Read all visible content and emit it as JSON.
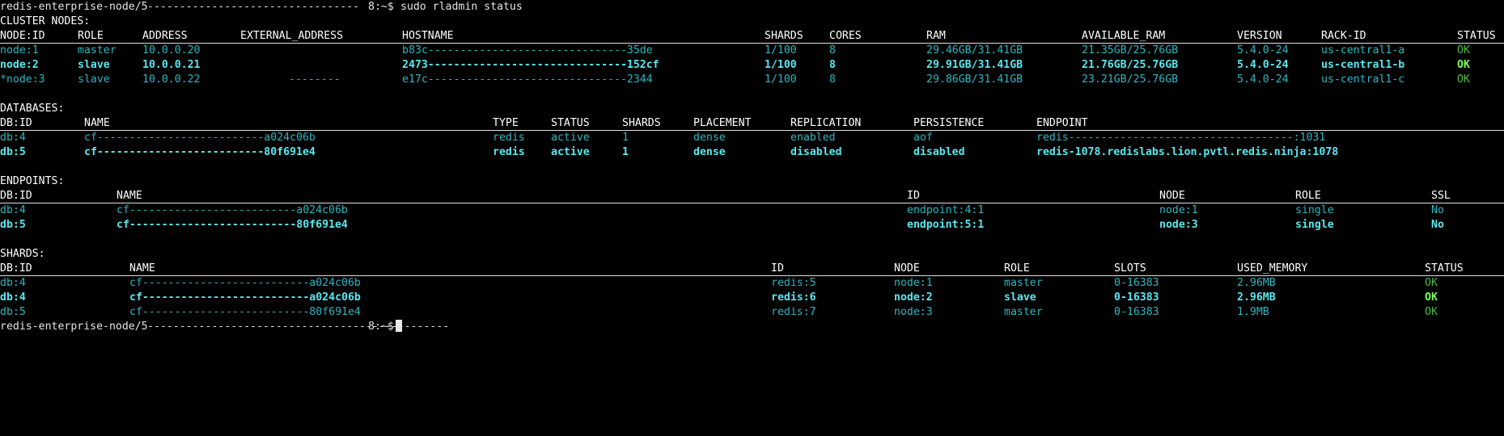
{
  "prompt_top": {
    "host": "redis-enterprise-node/5",
    "mask": "---------------------------------",
    "tail": "8:~$",
    "command": " sudo rladmin status"
  },
  "cluster": {
    "title": "CLUSTER NODES:",
    "headers": [
      "NODE:ID",
      "ROLE",
      "ADDRESS",
      "EXTERNAL_ADDRESS",
      "HOSTNAME",
      "SHARDS",
      "CORES",
      "RAM",
      "AVAILABLE_RAM",
      "VERSION",
      "RACK-ID",
      "STATUS"
    ],
    "rows": [
      {
        "node": "node:1",
        "role": "master",
        "address": "10.0.0.20",
        "external": "",
        "hostname": "b83c-------------------------------35de",
        "shards": "1/100",
        "cores": "8",
        "ram": "29.46GB/31.41GB",
        "avail": "21.35GB/25.76GB",
        "version": "5.4.0-24",
        "rack": "us-central1-a",
        "status": "OK"
      },
      {
        "node": "node:2",
        "role": "slave",
        "address": "10.0.0.21",
        "external": "",
        "hostname": "2473-------------------------------152cf",
        "shards": "1/100",
        "cores": "8",
        "ram": "29.91GB/31.41GB",
        "avail": "21.76GB/25.76GB",
        "version": "5.4.0-24",
        "rack": "us-central1-b",
        "status": "OK"
      },
      {
        "node": "*node:3",
        "role": "slave",
        "address": "10.0.0.22",
        "external": "--------",
        "hostname": "e17c-------------------------------2344",
        "shards": "1/100",
        "cores": "8",
        "ram": "29.86GB/31.41GB",
        "avail": "23.21GB/25.76GB",
        "version": "5.4.0-24",
        "rack": "us-central1-c",
        "status": "OK"
      }
    ]
  },
  "databases": {
    "title": "DATABASES:",
    "headers": [
      "DB:ID",
      "NAME",
      "TYPE",
      "STATUS",
      "SHARDS",
      "PLACEMENT",
      "REPLICATION",
      "PERSISTENCE",
      "ENDPOINT"
    ],
    "rows": [
      {
        "id": "db:4",
        "name": "cf--------------------------a024c06b",
        "type": "redis",
        "status": "active",
        "shards": "1",
        "placement": "dense",
        "replication": "enabled",
        "persistence": "aof",
        "endpoint": "redis-----------------------------------:1031"
      },
      {
        "id": "db:5",
        "name": "cf--------------------------80f691e4",
        "type": "redis",
        "status": "active",
        "shards": "1",
        "placement": "dense",
        "replication": "disabled",
        "persistence": "disabled",
        "endpoint": "redis-1078.redislabs.lion.pvtl.redis.ninja:1078"
      }
    ]
  },
  "endpoints": {
    "title": "ENDPOINTS:",
    "headers": [
      "DB:ID",
      "NAME",
      "ID",
      "NODE",
      "ROLE",
      "SSL"
    ],
    "rows": [
      {
        "id": "db:4",
        "name": "cf--------------------------a024c06b",
        "eid": "endpoint:4:1",
        "node": "node:1",
        "role": "single",
        "ssl": "No"
      },
      {
        "id": "db:5",
        "name": "cf--------------------------80f691e4",
        "eid": "endpoint:5:1",
        "node": "node:3",
        "role": "single",
        "ssl": "No"
      }
    ]
  },
  "shards": {
    "title": "SHARDS:",
    "headers": [
      "DB:ID",
      "NAME",
      "ID",
      "NODE",
      "ROLE",
      "SLOTS",
      "USED_MEMORY",
      "STATUS"
    ],
    "rows": [
      {
        "id": "db:4",
        "name": "cf--------------------------a024c06b",
        "sid": "redis:5",
        "node": "node:1",
        "role": "master",
        "slots": "0-16383",
        "mem": "2.96MB",
        "status": "OK"
      },
      {
        "id": "db:4",
        "name": "cf--------------------------a024c06b",
        "sid": "redis:6",
        "node": "node:2",
        "role": "slave",
        "slots": "0-16383",
        "mem": "2.96MB",
        "status": "OK"
      },
      {
        "id": "db:5",
        "name": "cf--------------------------80f691e4",
        "sid": "redis:7",
        "node": "node:3",
        "role": "master",
        "slots": "0-16383",
        "mem": "1.9MB",
        "status": "OK"
      }
    ]
  },
  "prompt_bottom": {
    "host": "redis-enterprise-node/5",
    "mask": "-----------------------------------------------",
    "tail": "8:~$"
  }
}
